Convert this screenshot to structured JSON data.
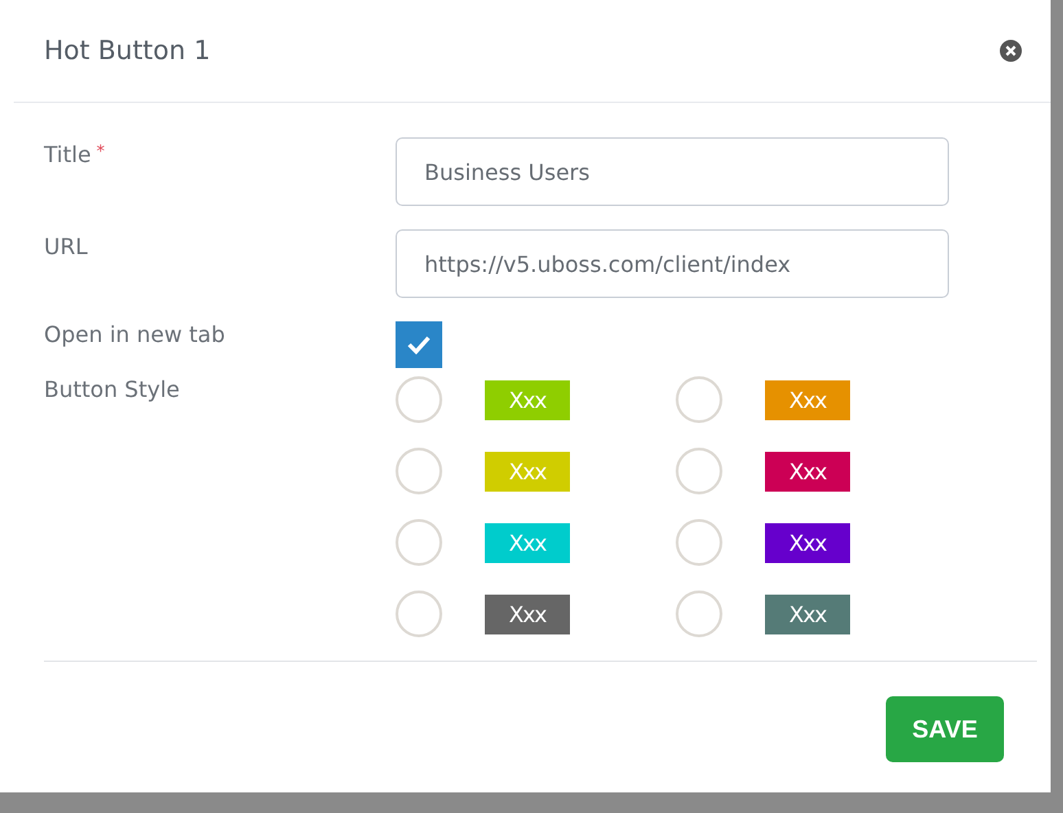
{
  "dialog": {
    "title": "Hot Button 1"
  },
  "fields": [
    {
      "label": "Title",
      "required_mark": "*",
      "value": "Business Users"
    },
    {
      "label": "URL",
      "value": "https://v5.uboss.com/client/index"
    }
  ],
  "open_in_new_tab": {
    "label": "Open in new tab",
    "checked": true
  },
  "button_style": {
    "label": "Button Style",
    "options": [
      {
        "text": "Xxx",
        "color": "#8fce00",
        "selected": false
      },
      {
        "text": "Xxx",
        "color": "#e69100",
        "selected": false
      },
      {
        "text": "Xxx",
        "color": "#d0cd00",
        "selected": false
      },
      {
        "text": "Xxx",
        "color": "#cc0055",
        "selected": false
      },
      {
        "text": "Xxx",
        "color": "#00cccc",
        "selected": false
      },
      {
        "text": "Xxx",
        "color": "#6600cc",
        "selected": false
      },
      {
        "text": "Xxx",
        "color": "#666666",
        "selected": false
      },
      {
        "text": "Xxx",
        "color": "#557b77",
        "selected": false
      }
    ]
  },
  "save_button": "SAVE"
}
